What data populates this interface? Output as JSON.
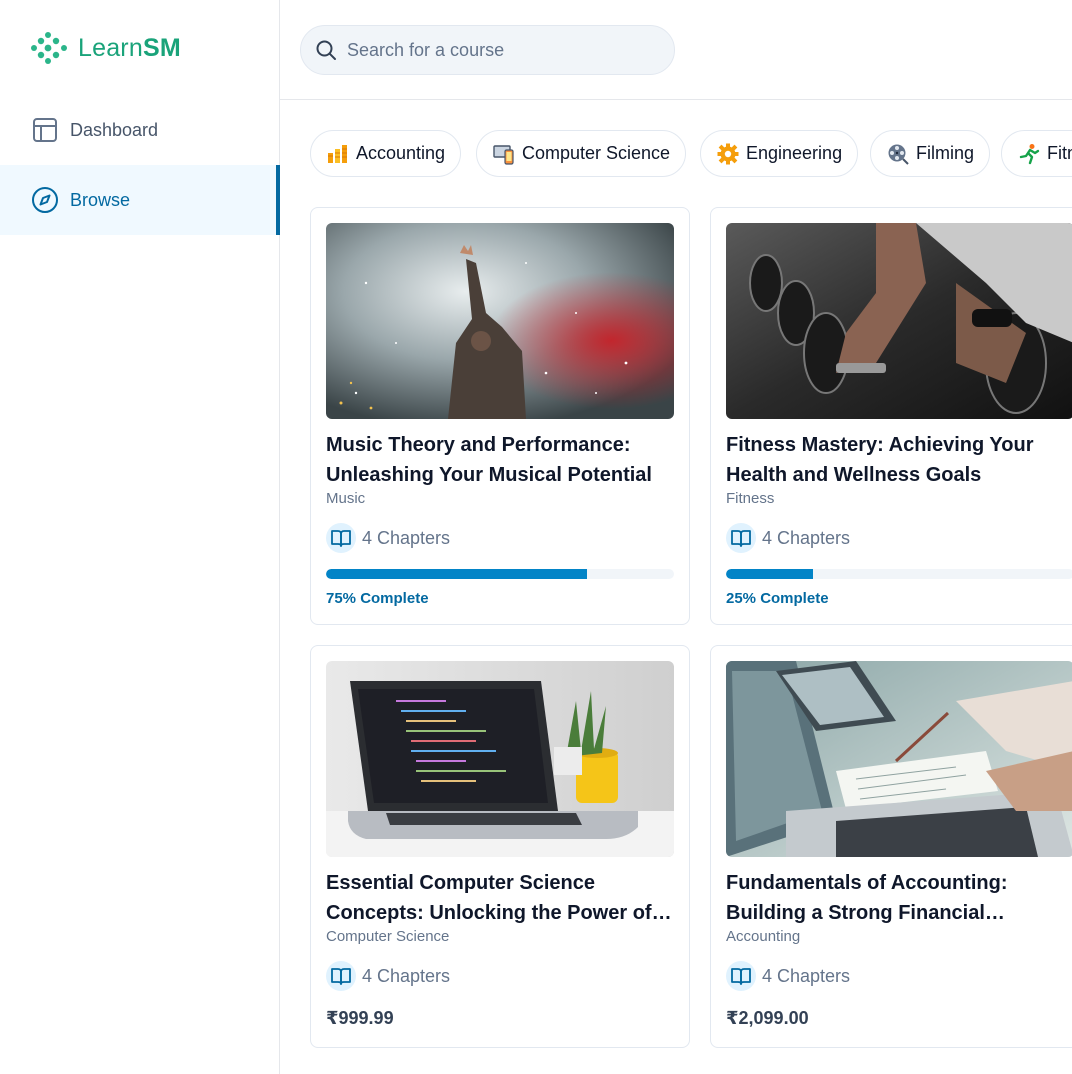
{
  "brand": {
    "name_prefix": "Learn",
    "name_suffix": "SM",
    "color": "#1aa37a"
  },
  "sidebar": {
    "items": [
      {
        "label": "Dashboard",
        "icon": "layout-icon",
        "active": false
      },
      {
        "label": "Browse",
        "icon": "compass-icon",
        "active": true
      }
    ]
  },
  "search": {
    "placeholder": "Search for a course",
    "value": ""
  },
  "categories": [
    {
      "label": "Accounting",
      "icon": "coins-icon"
    },
    {
      "label": "Computer Science",
      "icon": "devices-icon"
    },
    {
      "label": "Engineering",
      "icon": "gear-icon"
    },
    {
      "label": "Filming",
      "icon": "film-reel-icon"
    },
    {
      "label": "Fitness",
      "icon": "runner-icon"
    }
  ],
  "courses": [
    {
      "title": "Music Theory and Performance: Unleashing Your Musical Potential",
      "category": "Music",
      "chapters": "4 Chapters",
      "progress": 0.75,
      "progress_label": "75% Complete"
    },
    {
      "title": "Fitness Mastery: Achieving Your Health and Wellness Goals",
      "category": "Fitness",
      "chapters": "4 Chapters",
      "progress": 0.25,
      "progress_label": "25% Complete"
    },
    {
      "title": "Essential Computer Science Concepts: Unlocking the Power of Programming",
      "category": "Computer Science",
      "chapters": "4 Chapters",
      "price": "₹999.99"
    },
    {
      "title": "Fundamentals of Accounting: Building a Strong Financial Foundation",
      "category": "Accounting",
      "chapters": "4 Chapters",
      "price": "₹2,099.00"
    }
  ],
  "colors": {
    "accent": "#0369a1",
    "progress": "#0284c7",
    "active_bg": "#f0f9ff"
  }
}
